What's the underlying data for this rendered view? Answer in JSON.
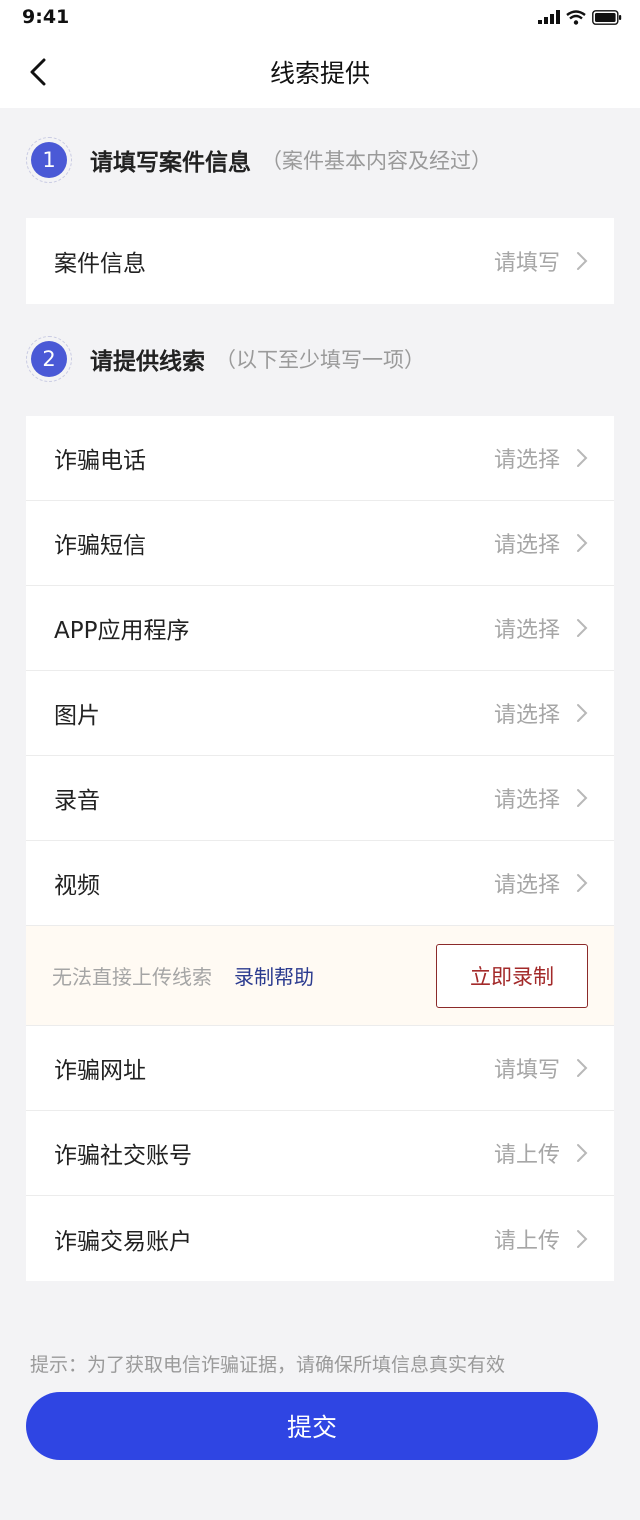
{
  "status_bar": {
    "time": "9:41"
  },
  "header": {
    "title": "线索提供"
  },
  "section1": {
    "number": "1",
    "title": "请填写案件信息",
    "hint": "（案件基本内容及经过）"
  },
  "case_info": {
    "label": "案件信息",
    "value": "请填写"
  },
  "section2": {
    "number": "2",
    "title": "请提供线索",
    "hint": "（以下至少填写一项）"
  },
  "clues_top": [
    {
      "label": "诈骗电话",
      "value": "请选择"
    },
    {
      "label": "诈骗短信",
      "value": "请选择"
    },
    {
      "label": "APP应用程序",
      "value": "请选择"
    },
    {
      "label": "图片",
      "value": "请选择"
    },
    {
      "label": "录音",
      "value": "请选择"
    },
    {
      "label": "视频",
      "value": "请选择"
    }
  ],
  "help": {
    "text": "无法直接上传线索",
    "link": "录制帮助",
    "button": "立即录制"
  },
  "clues_bottom": [
    {
      "label": "诈骗网址",
      "value": "请填写"
    },
    {
      "label": "诈骗社交账号",
      "value": "请上传"
    },
    {
      "label": "诈骗交易账户",
      "value": "请上传"
    }
  ],
  "tip": "提示：为了获取电信诈骗证据，请确保所填信息真实有效",
  "submit": {
    "label": "提交"
  },
  "colors": {
    "accent": "#2f45e3",
    "badge": "#4a59d6",
    "record": "#a32a2a",
    "link": "#2b3b8f"
  }
}
